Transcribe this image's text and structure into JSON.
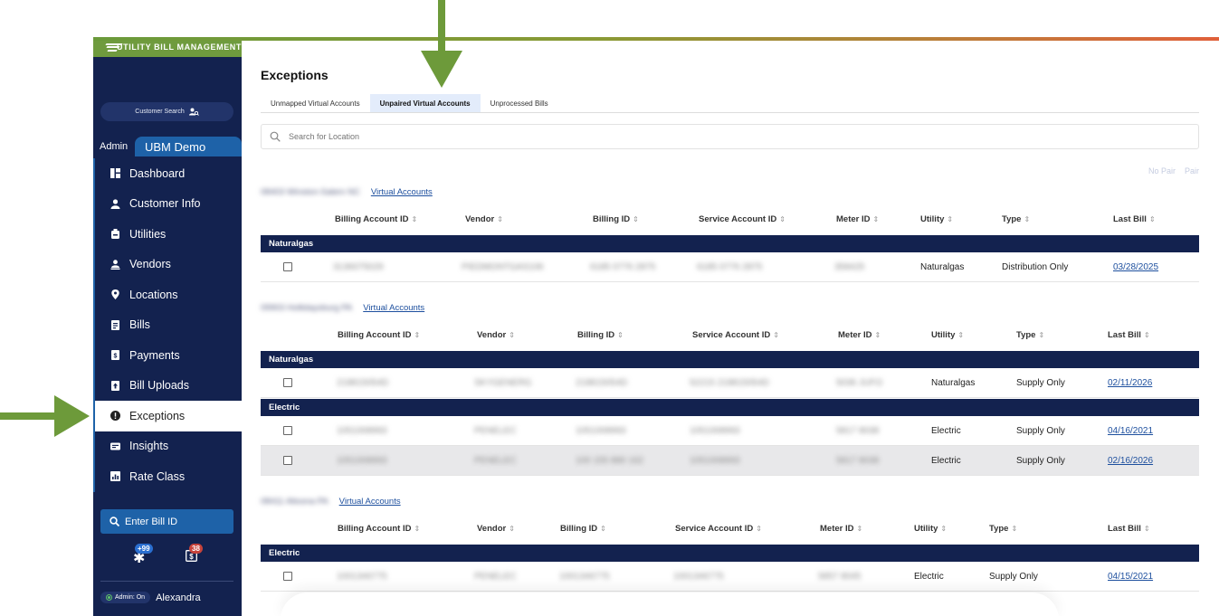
{
  "brand": {
    "title": "UTILITY BILL MANAGEMENT"
  },
  "sidebar": {
    "customer_search": "Customer Search",
    "admin_label": "Admin",
    "account_name": "UBM Demo",
    "items": [
      {
        "label": "Dashboard",
        "icon": "dashboard-icon"
      },
      {
        "label": "Customer Info",
        "icon": "person-icon"
      },
      {
        "label": "Utilities",
        "icon": "utility-icon"
      },
      {
        "label": "Vendors",
        "icon": "vendor-icon"
      },
      {
        "label": "Locations",
        "icon": "location-pin-icon"
      },
      {
        "label": "Bills",
        "icon": "bill-icon"
      },
      {
        "label": "Payments",
        "icon": "payment-icon"
      },
      {
        "label": "Bill Uploads",
        "icon": "upload-icon"
      },
      {
        "label": "Exceptions",
        "icon": "exclamation-icon",
        "active": true
      },
      {
        "label": "Insights",
        "icon": "insights-icon"
      },
      {
        "label": "Rate Class",
        "icon": "rate-class-icon"
      }
    ],
    "bill_id_placeholder": "Enter Bill ID",
    "badge_one": "+99",
    "badge_two": "38",
    "admin_status": "Admin: On",
    "user_name": "Alexandra"
  },
  "main": {
    "title": "Exceptions",
    "tabs": [
      {
        "label": "Unmapped Virtual Accounts",
        "active": false
      },
      {
        "label": "Unpaired Virtual Accounts",
        "active": true
      },
      {
        "label": "Unprocessed Bills",
        "active": false
      }
    ],
    "search_placeholder": "Search for Location",
    "pair_actions": {
      "no_pair": "No Pair",
      "pair": "Pair"
    },
    "columns": [
      "Billing Account ID",
      "Vendor",
      "Billing ID",
      "Service Account ID",
      "Meter ID",
      "Utility",
      "Type",
      "Last Bill"
    ],
    "sort_glyph": "⇕",
    "virtual_accounts_link": "Virtual Accounts",
    "locations": [
      {
        "name": "08403 Winston-Salem NC",
        "groups": [
          {
            "utility": "Naturalgas",
            "rows": [
              {
                "billing_account_id": "3136075029",
                "vendor": "PIEDMONTGAS106",
                "billing_id": "6185 0776 2875",
                "service_account_id": "6185 0776 2875",
                "meter_id": "358425",
                "utility": "Naturalgas",
                "type": "Distribution Only",
                "last_bill": "03/28/2025"
              }
            ]
          }
        ]
      },
      {
        "name": "09903 Hollidaysburg PA",
        "groups": [
          {
            "utility": "Naturalgas",
            "rows": [
              {
                "billing_account_id": "218815054D",
                "vendor": "SKYGENERG",
                "billing_id": "218815054D",
                "service_account_id": "52215 218815054D",
                "meter_id": "5036 JUFO",
                "utility": "Naturalgas",
                "type": "Supply Only",
                "last_bill": "02/11/2026"
              }
            ]
          },
          {
            "utility": "Electric",
            "rows": [
              {
                "billing_account_id": "1051008993",
                "vendor": "PENELEC",
                "billing_id": "1051008993",
                "service_account_id": "1051008993",
                "meter_id": "5817 8038",
                "utility": "Electric",
                "type": "Supply Only",
                "last_bill": "04/16/2021"
              },
              {
                "billing_account_id": "1051008993",
                "vendor": "PENELEC",
                "billing_id": "100 155 880 162",
                "service_account_id": "1051008993",
                "meter_id": "5817 8038",
                "utility": "Electric",
                "type": "Supply Only",
                "last_bill": "02/16/2026"
              }
            ]
          }
        ]
      },
      {
        "name": "08411 Altoona PA",
        "groups": [
          {
            "utility": "Electric",
            "rows": [
              {
                "billing_account_id": "1001346775",
                "vendor": "PENELEC",
                "billing_id": "1001346775",
                "service_account_id": "1001346775",
                "meter_id": "5857 8045",
                "utility": "Electric",
                "type": "Supply Only",
                "last_bill": "04/15/2021"
              }
            ]
          }
        ]
      }
    ]
  },
  "colors": {
    "navy": "#13224f",
    "accent_blue": "#1e62a8",
    "brand_green": "#6f9b3e",
    "arrow_green": "#6d9a3a",
    "link": "#1d4f9e"
  }
}
